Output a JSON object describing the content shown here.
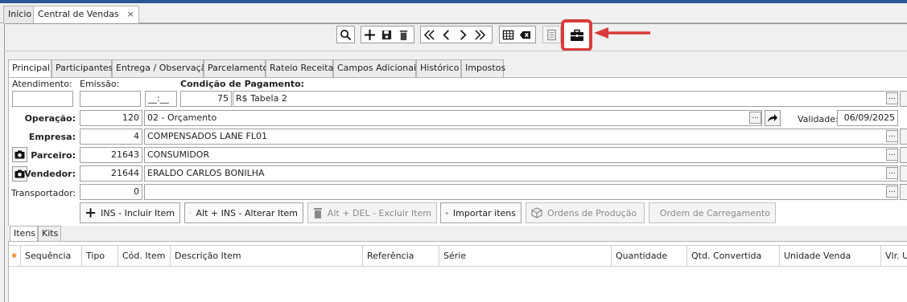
{
  "doc_tabs": [
    {
      "label": "Início"
    },
    {
      "label": "Central de Vendas",
      "close": "×"
    }
  ],
  "page_tabs": [
    "Principal",
    "Participantes",
    "Entrega / Observação",
    "Parcelamento",
    "Rateio Receita",
    "Campos Adicionais",
    "Histórico",
    "Impostos"
  ],
  "form": {
    "atendimento_label": "Atendimento:",
    "emissao_label": "Emissão:",
    "condicao_label": "Condição de Pagamento:",
    "hora_value": "__:__",
    "condicao_code": "75",
    "condicao_desc": "R$ Tabela 2",
    "operacao_label": "Operação:",
    "operacao_code": "120",
    "operacao_desc": "02 - Orçamento",
    "validade_label": "Validade:",
    "validade_value": "06/09/2025",
    "empresa_label": "Empresa:",
    "empresa_code": "4",
    "empresa_desc": "COMPENSADOS LANE FL01",
    "parceiro_label": "Parceiro:",
    "parceiro_code": "21643",
    "parceiro_desc": "CONSUMIDOR",
    "vendedor_label": "Vendedor:",
    "vendedor_code": "21644",
    "vendedor_desc": "ERALDO CARLOS BONILHA",
    "transportador_label": "Transportador:",
    "transportador_code": "0",
    "transportador_desc": "",
    "dots": "..."
  },
  "actions": {
    "incluir": "INS - Incluir Item",
    "alterar": "Alt + INS - Alterar Item",
    "excluir": "Alt + DEL - Excluir Item",
    "importar": "Importar itens",
    "ordens_producao": "Ordens de Produção",
    "ordem_carregamento": "Ordem de Carregamento"
  },
  "grid_tabs": [
    "Itens",
    "Kits"
  ],
  "grid_columns": [
    "Sequência",
    "Tipo",
    "Cód. Item",
    "Descrição Item",
    "Referência",
    "Série",
    "Quantidade",
    "Qtd. Convertida",
    "Unidade Venda",
    "Vlr. U"
  ],
  "colors": {
    "highlight": "#d93b3b",
    "topbar": "#2b5797"
  }
}
